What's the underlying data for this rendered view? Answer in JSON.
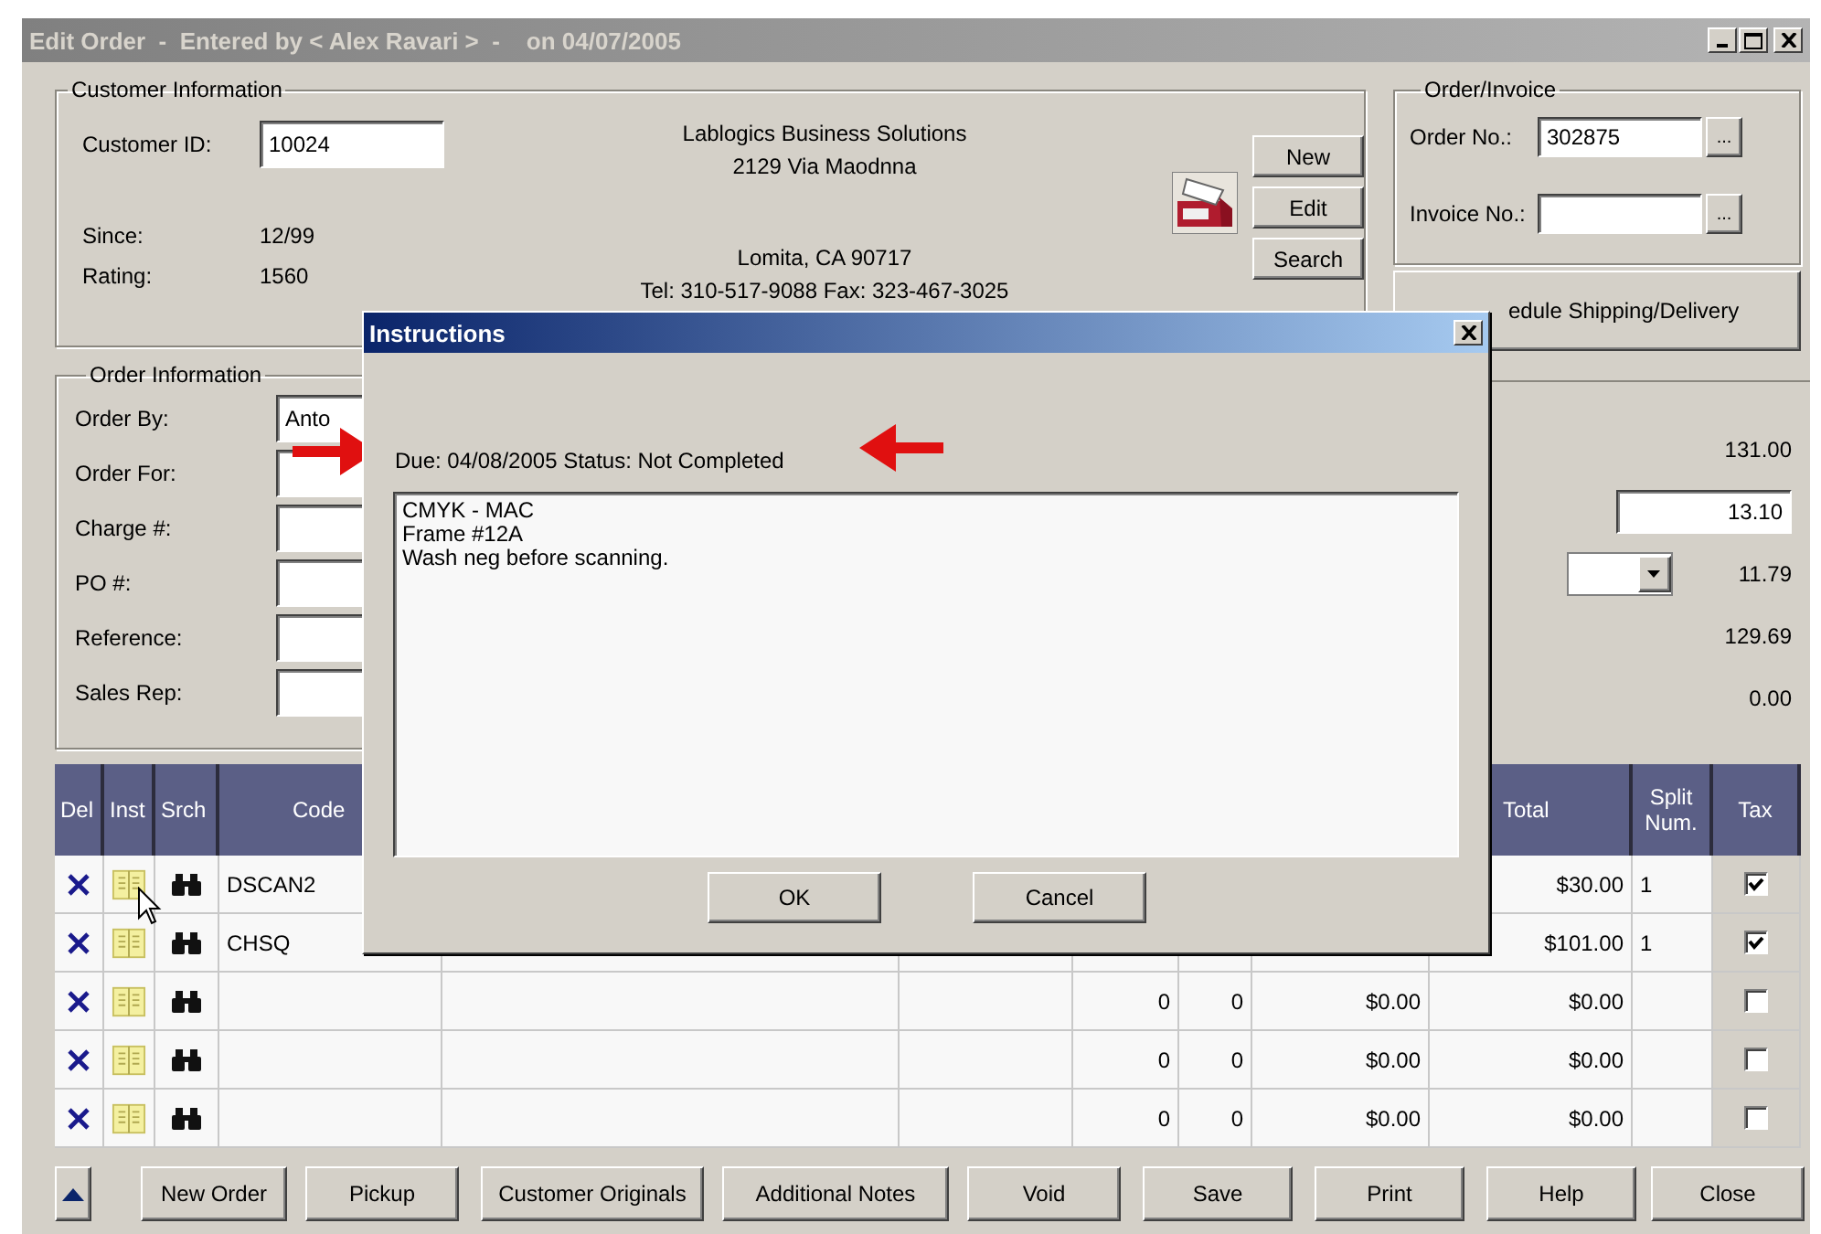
{
  "window": {
    "title": "Edit Order  -  Entered by < Alex Ravari >  -    on 04/07/2005"
  },
  "customer_information": {
    "legend": "Customer Information",
    "customer_id_label": "Customer ID:",
    "customer_id": "10024",
    "since_label": "Since:",
    "since": "12/99",
    "rating_label": "Rating:",
    "rating": "1560",
    "company": {
      "name": "Lablogics Business Solutions",
      "street": "2129 Via Maodnna",
      "city": "Lomita, CA 90717",
      "phone": "Tel: 310-517-9088  Fax: 323-467-3025"
    },
    "buttons": [
      "New",
      "Edit",
      "Search"
    ]
  },
  "order_invoice": {
    "legend": "Order/Invoice",
    "order_no_label": "Order No.:",
    "order_no": "302875",
    "invoice_no_label": "Invoice No.:",
    "browse_button": "..."
  },
  "schedule_button": "edule Shipping/Delivery",
  "order_information": {
    "legend": "Order Information",
    "fields": [
      {
        "label": "Order By:",
        "value": "Anto"
      },
      {
        "label": "Order For:"
      },
      {
        "label": "Charge #:"
      },
      {
        "label": "PO #:"
      },
      {
        "label": "Reference:"
      },
      {
        "label": "Sales Rep:"
      }
    ]
  },
  "totals": [
    {
      "kind": "text",
      "value": "131.00"
    },
    {
      "kind": "input",
      "value": "13.10"
    },
    {
      "kind": "dropdown",
      "value": "11.79"
    },
    {
      "kind": "text",
      "value": "129.69"
    },
    {
      "kind": "text",
      "value": "0.00"
    }
  ],
  "table": {
    "headers": {
      "del": "Del",
      "inst": "Inst",
      "srch": "Srch",
      "code": "Code",
      "total": "Total",
      "split": "Split Num.",
      "tax": "Tax"
    },
    "rows": [
      {
        "code": "DSCAN2",
        "total": "$30.00",
        "split": "1",
        "tax": true
      },
      {
        "code": "CHSQ",
        "total": "$101.00",
        "split": "1",
        "tax": true
      },
      {
        "column_7": "0",
        "column_8": "0",
        "column_9": "$0.00",
        "total": "$0.00",
        "tax": false
      },
      {
        "column_7": "0",
        "column_8": "0",
        "column_9": "$0.00",
        "total": "$0.00",
        "tax": false
      },
      {
        "column_7": "0",
        "column_8": "0",
        "column_9": "$0.00",
        "total": "$0.00",
        "tax": false
      }
    ]
  },
  "bottom_buttons": [
    "New Order",
    "Pickup",
    "Customer Originals",
    "Additional Notes",
    "Void",
    "Save",
    "Print",
    "Help",
    "Close"
  ],
  "dialog": {
    "title": "Instructions",
    "status": "Due: 04/08/2005 Status: Not Completed",
    "notes": [
      "CMYK - MAC",
      "Frame #12A",
      "Wash neg before scanning."
    ],
    "buttons": [
      "OK",
      "Cancel"
    ]
  }
}
